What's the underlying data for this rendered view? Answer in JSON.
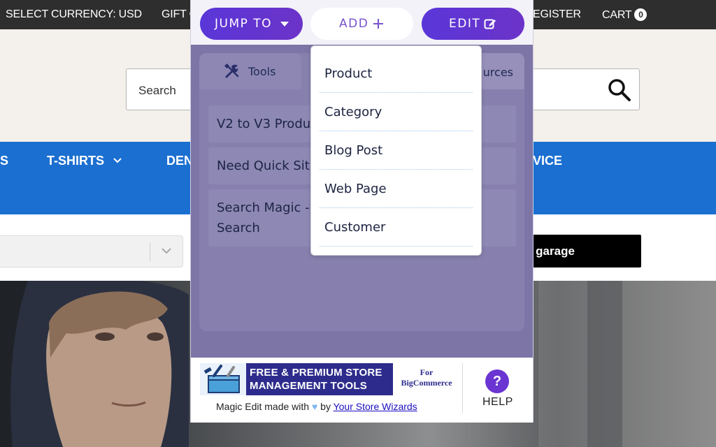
{
  "store": {
    "topbar": {
      "currency": "SELECT CURRENCY: USD",
      "gift": "GIFT C",
      "register": "EGISTER",
      "cart_label": "CART",
      "cart_count": "0"
    },
    "search": {
      "placeholder": "Search"
    },
    "nav": {
      "item_left": "S",
      "tshirts": "T-SHIRTS",
      "den": "DEN",
      "vice": "VICE"
    },
    "garage_button": "y garage"
  },
  "panel": {
    "buttons": {
      "jump_to": "JUMP TO",
      "add": "ADD",
      "edit": "EDIT"
    },
    "tabs": {
      "tools": "Tools",
      "resources": "urces"
    },
    "tools": [
      "V2 to V3 Produ",
      "Need Quick Sit",
      "Search Magic -",
      "Search"
    ],
    "add_menu": [
      "Product",
      "Category",
      "Blog Post",
      "Web Page",
      "Customer"
    ],
    "footer": {
      "banner_line1": "FREE & PREMIUM STORE",
      "banner_line2": "MANAGEMENT TOOLS",
      "banner_for_line1": "For",
      "banner_for_line2": "BigCommerce",
      "credit_prefix": "Magic Edit made with",
      "credit_by": "by",
      "credit_link": "Your Store Wizards",
      "help_icon": "?",
      "help_label": "HELP"
    }
  },
  "colors": {
    "accent_purple": "#5a36d8",
    "nav_blue": "#1b6fd0",
    "overlay": "#7c75a6"
  }
}
